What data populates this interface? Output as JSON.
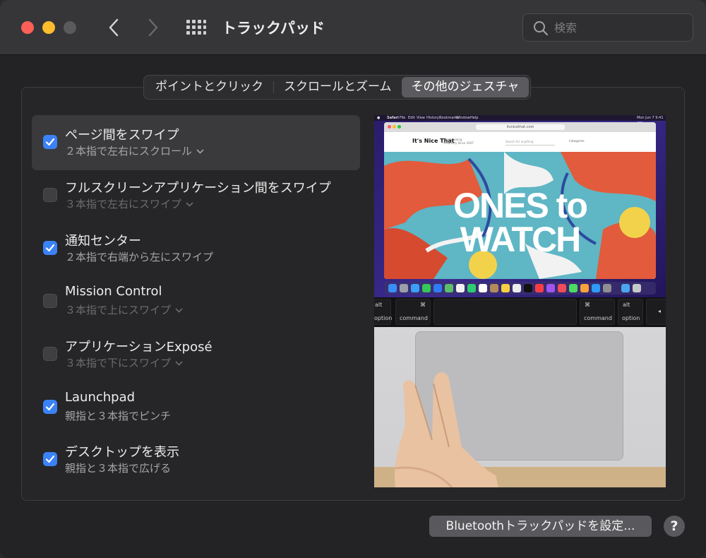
{
  "window": {
    "title": "トラックパッド"
  },
  "search": {
    "placeholder": "検索"
  },
  "tabs": [
    {
      "label": "ポイントとクリック",
      "active": false
    },
    {
      "label": "スクロールとズーム",
      "active": false
    },
    {
      "label": "その他のジェスチャ",
      "active": true
    }
  ],
  "gestures": [
    {
      "title": "ページ間をスワイプ",
      "subtitle": "２本指で左右にスクロール",
      "checked": true,
      "has_dropdown": true
    },
    {
      "title": "フルスクリーンアプリケーション間をスワイプ",
      "subtitle": "３本指で左右にスワイプ",
      "checked": false,
      "has_dropdown": true
    },
    {
      "title": "通知センター",
      "subtitle": "２本指で右端から左にスワイプ",
      "checked": true,
      "has_dropdown": false
    },
    {
      "title": "Mission Control",
      "subtitle": "３本指で上にスワイプ",
      "checked": false,
      "has_dropdown": true
    },
    {
      "title": "アプリケーションExposé",
      "subtitle": "３本指で下にスワイプ",
      "checked": false,
      "has_dropdown": true
    },
    {
      "title": "Launchpad",
      "subtitle": "親指と３本指でピンチ",
      "checked": true,
      "has_dropdown": false
    },
    {
      "title": "デスクトップを表示",
      "subtitle": "親指と３本指で広げる",
      "checked": true,
      "has_dropdown": false
    }
  ],
  "preview": {
    "menubar_items": [
      "Safari",
      "File",
      "Edit",
      "View",
      "History",
      "Bookmarks",
      "Window",
      "Help"
    ],
    "menubar_clock": "Mon Jun 7  9:41 AM",
    "url": "itsnicethat.com",
    "site_logo": "It's Nice That",
    "site_tagline": "Championing Creativity Since 2007",
    "site_search": "Search for anything",
    "site_categories": "Categories",
    "hero_line1": "ONES to",
    "hero_line2": "WATCH",
    "keys": [
      {
        "top": "alt",
        "bottom": "option"
      },
      {
        "top": "⌘",
        "bottom": "command"
      },
      {
        "top": "⌘",
        "bottom": "command"
      },
      {
        "top": "alt",
        "bottom": "option"
      }
    ]
  },
  "footer": {
    "bluetooth_label": "Bluetoothトラックパッドを設定...",
    "help_label": "?"
  },
  "colors": {
    "checkbox_on": "#3b82f6",
    "selected_row": "#3a3a3c",
    "traffic_close": "#fe5f57",
    "traffic_min": "#febc2e"
  }
}
